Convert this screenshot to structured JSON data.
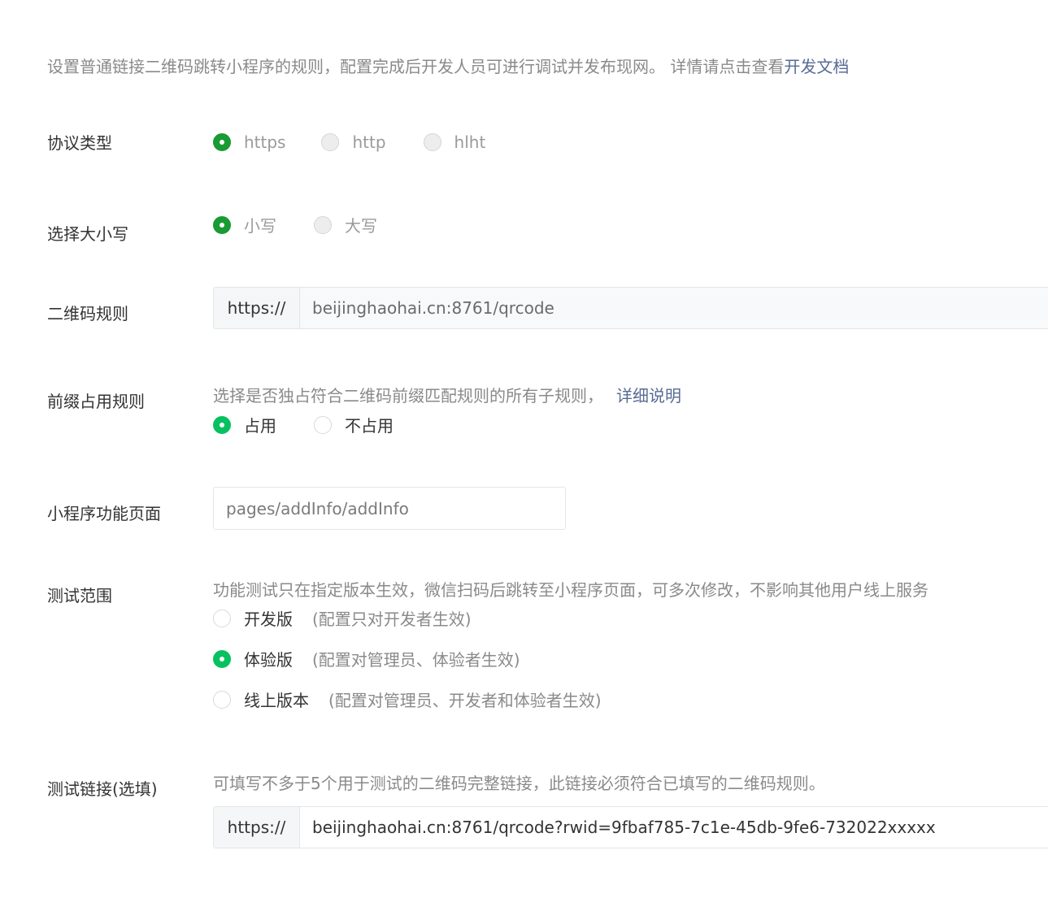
{
  "intro": {
    "text": "设置普通链接二维码跳转小程序的规则，配置完成后开发人员可进行调试并发布现网。 详情请点击查看",
    "link": "开发文档"
  },
  "protocol": {
    "label": "协议类型",
    "options": [
      "https",
      "http",
      "hlht"
    ],
    "selected": "https"
  },
  "case": {
    "label": "选择大小写",
    "options": [
      "小写",
      "大写"
    ],
    "selected": "小写"
  },
  "qrcode_rule": {
    "label": "二维码规则",
    "prefix": "https://",
    "value": "beijinghaohai.cn:8761/qrcode"
  },
  "prefix_rule": {
    "label": "前缀占用规则",
    "description": "选择是否独占符合二维码前缀匹配规则的所有子规则，",
    "link": "详细说明",
    "options": [
      "占用",
      "不占用"
    ],
    "selected": "占用"
  },
  "page_path": {
    "label": "小程序功能页面",
    "value": "pages/addInfo/addInfo"
  },
  "test_scope": {
    "label": "测试范围",
    "description": "功能测试只在指定版本生效，微信扫码后跳转至小程序页面，可多次修改，不影响其他用户线上服务",
    "options": [
      {
        "text": "开发版",
        "hint": "(配置只对开发者生效)"
      },
      {
        "text": "体验版",
        "hint": "(配置对管理员、体验者生效)"
      },
      {
        "text": "线上版本",
        "hint": "(配置对管理员、开发者和体验者生效)"
      }
    ],
    "selected": "体验版"
  },
  "test_link": {
    "label": "测试链接(选填)",
    "description": "可填写不多于5个用于测试的二维码完整链接，此链接必须符合已填写的二维码规则。",
    "prefix": "https://",
    "value": "beijinghaohai.cn:8761/qrcode?rwid=9fbaf785-7c1e-45db-9fe6-732022xxxxx"
  },
  "colors": {
    "accent": "#07c160",
    "accent_disabled": "#1a9a32",
    "link": "#576b95"
  }
}
